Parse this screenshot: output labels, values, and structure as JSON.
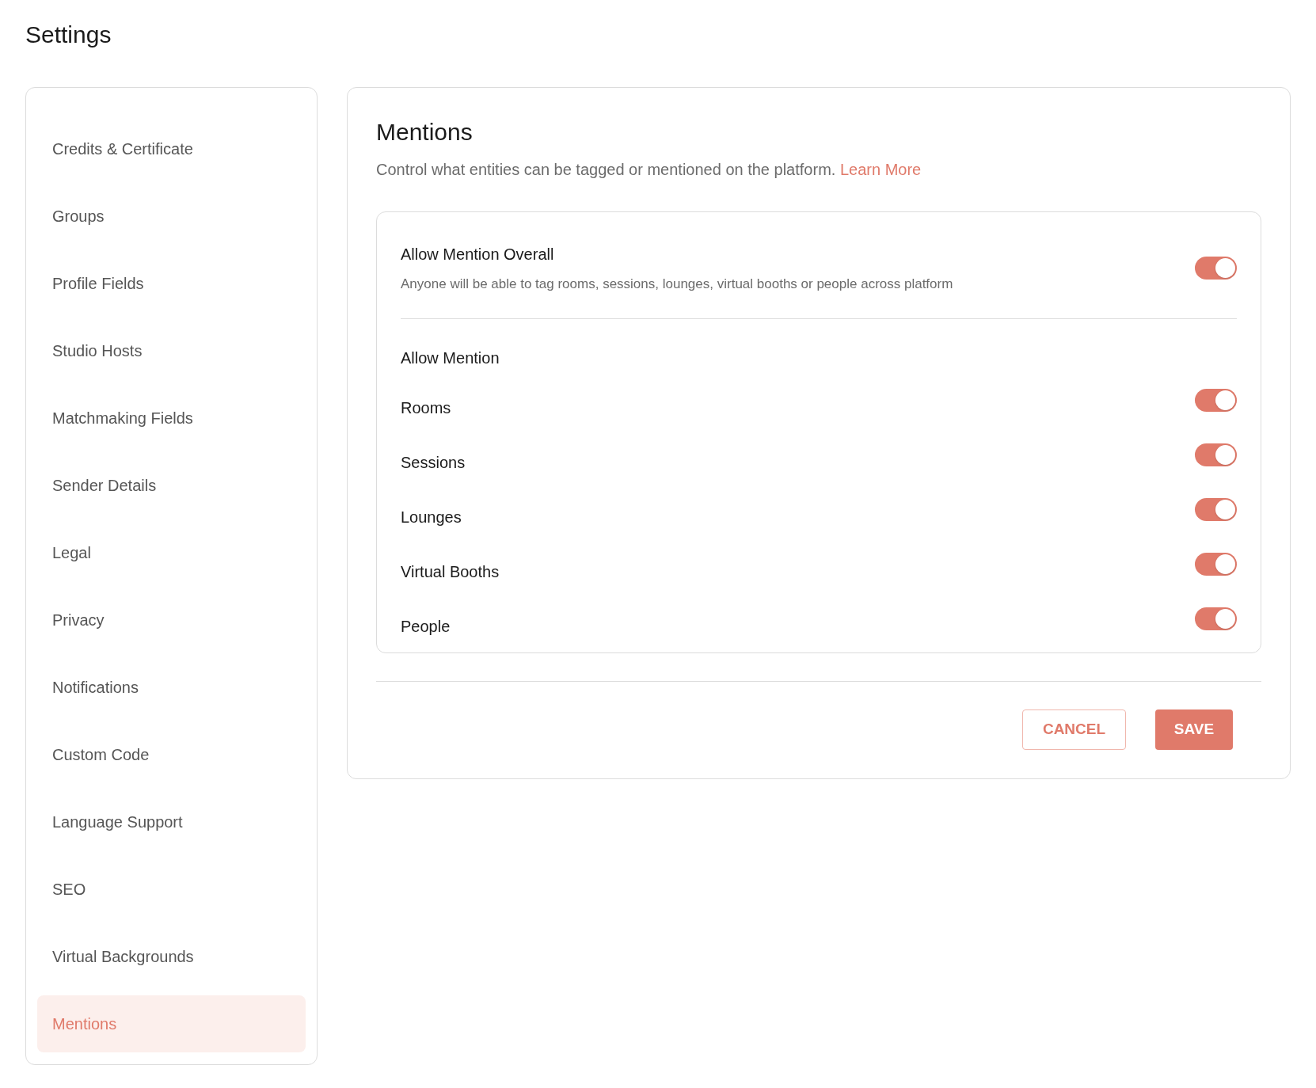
{
  "page_title": "Settings",
  "sidebar": {
    "items": [
      {
        "label": "Credits & Certificate",
        "selected": false
      },
      {
        "label": "Groups",
        "selected": false
      },
      {
        "label": "Profile Fields",
        "selected": false
      },
      {
        "label": "Studio Hosts",
        "selected": false
      },
      {
        "label": "Matchmaking Fields",
        "selected": false
      },
      {
        "label": "Sender Details",
        "selected": false
      },
      {
        "label": "Legal",
        "selected": false
      },
      {
        "label": "Privacy",
        "selected": false
      },
      {
        "label": "Notifications",
        "selected": false
      },
      {
        "label": "Custom Code",
        "selected": false
      },
      {
        "label": "Language Support",
        "selected": false
      },
      {
        "label": "SEO",
        "selected": false
      },
      {
        "label": "Virtual Backgrounds",
        "selected": false
      },
      {
        "label": "Mentions",
        "selected": true
      }
    ]
  },
  "panel": {
    "title": "Mentions",
    "description": "Control what entities can be tagged or mentioned on the platform.",
    "link": "Learn More",
    "overall": {
      "label": "Allow Mention Overall",
      "description": "Anyone will be able to tag rooms, sessions, lounges, virtual booths or people across platform",
      "on": true
    },
    "allow_mention": {
      "heading": "Allow Mention",
      "items": [
        {
          "label": "Rooms",
          "on": true
        },
        {
          "label": "Sessions",
          "on": true
        },
        {
          "label": "Lounges",
          "on": true
        },
        {
          "label": "Virtual Booths",
          "on": true
        },
        {
          "label": "People",
          "on": true
        }
      ]
    },
    "buttons": {
      "cancel": "CANCEL",
      "save": "SAVE"
    }
  }
}
